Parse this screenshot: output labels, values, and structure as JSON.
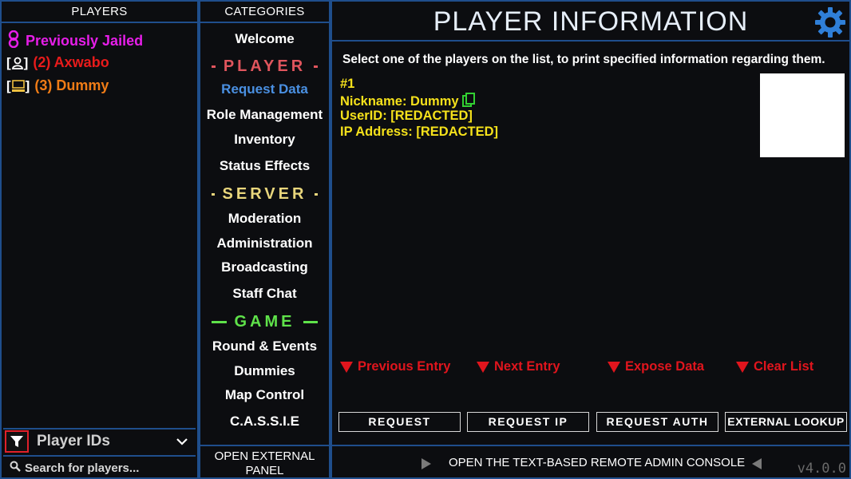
{
  "players_panel": {
    "header": "PLAYERS",
    "jailed_label": "Previously Jailed",
    "players": [
      {
        "bracket_open": "[",
        "bracket_close": "]",
        "label": "(2) Axwabo",
        "color": "#e81b1b",
        "icon": "user-icon"
      },
      {
        "bracket_open": "[",
        "bracket_close": "]",
        "label": "(3) Dummy",
        "color": "#f07c16",
        "icon": "computer-icon"
      }
    ],
    "filter_label": "Player IDs",
    "search_placeholder": "Search for players..."
  },
  "categories": {
    "header": "CATEGORIES",
    "welcome": "Welcome",
    "sections": [
      {
        "title": "PLAYER",
        "color": "#e0555d",
        "items": [
          "Request Data",
          "Role Management",
          "Inventory",
          "Status Effects"
        ]
      },
      {
        "title": "SERVER",
        "color": "#e9d67c",
        "items": [
          "Moderation",
          "Administration",
          "Broadcasting",
          "Staff Chat"
        ]
      },
      {
        "title": "GAME",
        "color": "#5fe24a",
        "items": [
          "Round & Events",
          "Dummies",
          "Map Control",
          "C.A.S.S.I.E"
        ]
      }
    ],
    "active_item": "Request Data",
    "open_external": "OPEN EXTERNAL PANEL"
  },
  "main": {
    "title": "PLAYER INFORMATION",
    "instruction": "Select one of the players on the list, to print specified information regarding them.",
    "info": {
      "id": "#1",
      "nickname": "Nickname: Dummy",
      "userid": "UserID: [REDACTED]",
      "ip": "IP Address: [REDACTED]"
    },
    "actions": [
      "Previous Entry",
      "Next Entry",
      "Expose Data",
      "Clear List"
    ],
    "buttons": [
      "REQUEST",
      "REQUEST IP",
      "REQUEST AUTH",
      "EXTERNAL LOOKUP"
    ],
    "console_label": "OPEN THE TEXT-BASED REMOTE ADMIN CONSOLE",
    "version": "v4.0.0"
  },
  "colors": {
    "border": "#1f4e8c",
    "jailed": "#e61ee8",
    "info_text": "#f5e11b",
    "action_red": "#e0151d",
    "accent_blue": "#4a90e2",
    "copy_green": "#32d132",
    "gear": "#2f7fd8"
  }
}
